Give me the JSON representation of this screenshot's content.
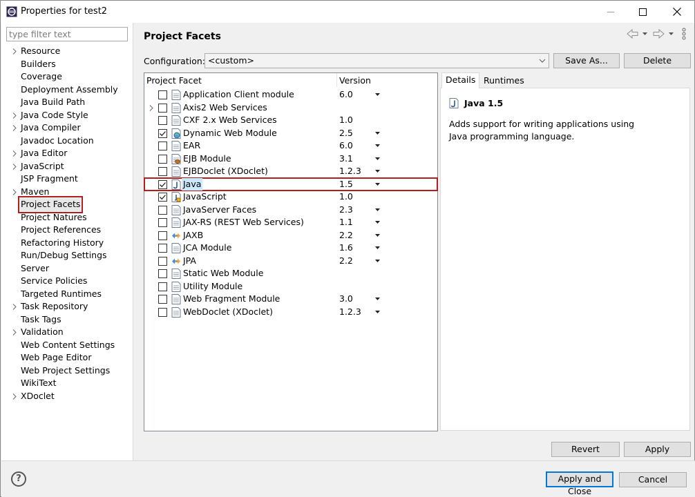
{
  "window": {
    "title": "Properties for test2"
  },
  "filter": {
    "placeholder": "type filter text"
  },
  "tree": [
    {
      "label": "Resource",
      "expandable": true
    },
    {
      "label": "Builders",
      "expandable": false
    },
    {
      "label": "Coverage",
      "expandable": false
    },
    {
      "label": "Deployment Assembly",
      "expandable": false
    },
    {
      "label": "Java Build Path",
      "expandable": false
    },
    {
      "label": "Java Code Style",
      "expandable": true
    },
    {
      "label": "Java Compiler",
      "expandable": true
    },
    {
      "label": "Javadoc Location",
      "expandable": false
    },
    {
      "label": "Java Editor",
      "expandable": true
    },
    {
      "label": "JavaScript",
      "expandable": true
    },
    {
      "label": "JSP Fragment",
      "expandable": false
    },
    {
      "label": "Maven",
      "expandable": true
    },
    {
      "label": "Project Facets",
      "expandable": false,
      "selected": true
    },
    {
      "label": "Project Natures",
      "expandable": false
    },
    {
      "label": "Project References",
      "expandable": false
    },
    {
      "label": "Refactoring History",
      "expandable": false
    },
    {
      "label": "Run/Debug Settings",
      "expandable": false
    },
    {
      "label": "Server",
      "expandable": false
    },
    {
      "label": "Service Policies",
      "expandable": false
    },
    {
      "label": "Targeted Runtimes",
      "expandable": false
    },
    {
      "label": "Task Repository",
      "expandable": true
    },
    {
      "label": "Task Tags",
      "expandable": false
    },
    {
      "label": "Validation",
      "expandable": true
    },
    {
      "label": "Web Content Settings",
      "expandable": false
    },
    {
      "label": "Web Page Editor",
      "expandable": false
    },
    {
      "label": "Web Project Settings",
      "expandable": false
    },
    {
      "label": "WikiText",
      "expandable": false
    },
    {
      "label": "XDoclet",
      "expandable": true
    }
  ],
  "page": {
    "title": "Project Facets"
  },
  "config": {
    "label": "Configuration:",
    "value": "<custom>",
    "save_as": "Save As...",
    "delete": "Delete"
  },
  "facets": {
    "col_facet": "Project Facet",
    "col_version": "Version",
    "rows": [
      {
        "name": "Application Client module",
        "version": "6.0",
        "checked": false,
        "dropdown": true,
        "icon": "file-icon"
      },
      {
        "name": "Axis2 Web Services",
        "version": "",
        "checked": false,
        "dropdown": false,
        "icon": "file-icon",
        "expandable": true
      },
      {
        "name": "CXF 2.x Web Services",
        "version": "1.0",
        "checked": false,
        "dropdown": false,
        "icon": "file-icon"
      },
      {
        "name": "Dynamic Web Module",
        "version": "2.5",
        "checked": true,
        "dropdown": true,
        "icon": "globe-icon"
      },
      {
        "name": "EAR",
        "version": "6.0",
        "checked": false,
        "dropdown": true,
        "icon": "file-icon"
      },
      {
        "name": "EJB Module",
        "version": "3.1",
        "checked": false,
        "dropdown": true,
        "icon": "bean-icon"
      },
      {
        "name": "EJBDoclet (XDoclet)",
        "version": "1.2.3",
        "checked": false,
        "dropdown": true,
        "icon": "file-icon"
      },
      {
        "name": "Java",
        "version": "1.5",
        "checked": true,
        "dropdown": true,
        "icon": "java-icon",
        "highlight": true
      },
      {
        "name": "JavaScript",
        "version": "1.0",
        "checked": true,
        "dropdown": false,
        "icon": "javascript-icon"
      },
      {
        "name": "JavaServer Faces",
        "version": "2.3",
        "checked": false,
        "dropdown": true,
        "icon": "file-icon"
      },
      {
        "name": "JAX-RS (REST Web Services)",
        "version": "1.1",
        "checked": false,
        "dropdown": true,
        "icon": "file-icon"
      },
      {
        "name": "JAXB",
        "version": "2.2",
        "checked": false,
        "dropdown": true,
        "icon": "arrows-icon"
      },
      {
        "name": "JCA Module",
        "version": "1.6",
        "checked": false,
        "dropdown": true,
        "icon": "file-icon"
      },
      {
        "name": "JPA",
        "version": "2.2",
        "checked": false,
        "dropdown": true,
        "icon": "arrows-icon"
      },
      {
        "name": "Static Web Module",
        "version": "",
        "checked": false,
        "dropdown": false,
        "icon": "file-icon"
      },
      {
        "name": "Utility Module",
        "version": "",
        "checked": false,
        "dropdown": false,
        "icon": "file-icon"
      },
      {
        "name": "Web Fragment Module",
        "version": "3.0",
        "checked": false,
        "dropdown": true,
        "icon": "file-icon"
      },
      {
        "name": "WebDoclet (XDoclet)",
        "version": "1.2.3",
        "checked": false,
        "dropdown": true,
        "icon": "file-icon"
      }
    ]
  },
  "details": {
    "tab_details": "Details",
    "tab_runtimes": "Runtimes",
    "title": "Java 1.5",
    "description": "Adds support for writing applications using Java programming language."
  },
  "buttons": {
    "revert": "Revert",
    "apply": "Apply",
    "apply_close": "Apply and Close",
    "cancel": "Cancel"
  },
  "help": {
    "glyph": "?"
  },
  "colors": {
    "highlight_border": "#b71c1c",
    "selection": "#cce8ff",
    "accent": "#0078d7"
  }
}
